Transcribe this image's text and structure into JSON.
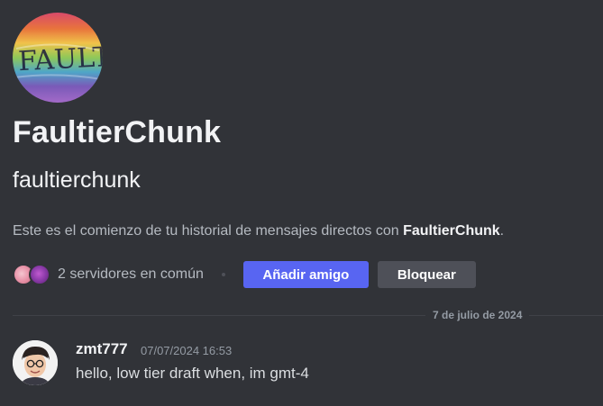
{
  "profile": {
    "avatar_text": "FAULTY",
    "display_name": "FaultierChunk",
    "username": "faultierchunk",
    "intro_prefix": "Este es el comienzo de tu historial de mensajes directos con ",
    "intro_name": "FaultierChunk",
    "intro_suffix": "."
  },
  "mutual": {
    "text": "2 servidores en común",
    "add_friend_label": "Añadir amigo",
    "block_label": "Bloquear"
  },
  "divider": {
    "date": "7 de julio de 2024"
  },
  "message": {
    "author": "zmt777",
    "timestamp": "07/07/2024 16:53",
    "text": "hello, low tier draft when, im gmt-4"
  },
  "colors": {
    "background": "#313338",
    "primary_button": "#5865f2",
    "secondary_button": "#4e5058",
    "muted_text": "#949ba4"
  }
}
